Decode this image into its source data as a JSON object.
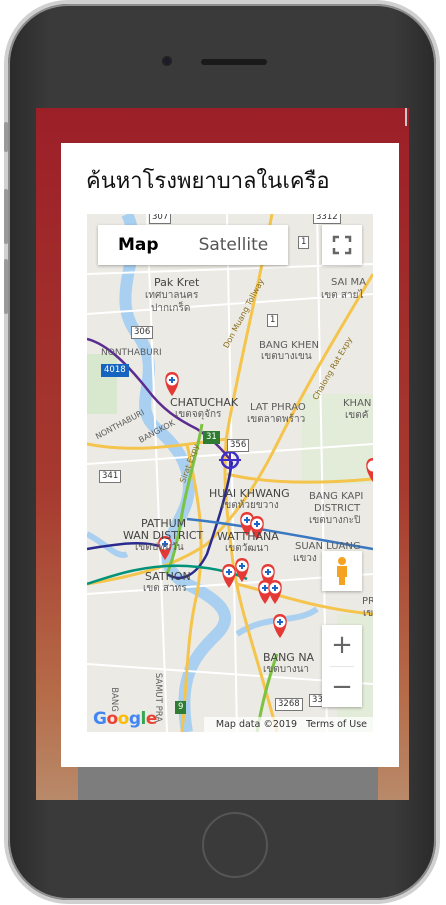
{
  "modal": {
    "title": "ค้นหาโรงพยาบาลในเครือ"
  },
  "map": {
    "map_type": {
      "map_label": "Map",
      "satellite_label": "Satellite"
    },
    "zoom": {
      "in_label": "+",
      "out_label": "−"
    },
    "footer": {
      "map_data": "Map data ©2019",
      "terms": "Terms of Use"
    },
    "google_logo": [
      "G",
      "o",
      "o",
      "g",
      "l",
      "e"
    ],
    "google_colors": [
      "#4285F4",
      "#EA4335",
      "#FBBC05",
      "#4285F4",
      "#34A853",
      "#EA4335"
    ],
    "places": {
      "pak_kret_en": "Pak Kret",
      "pak_kret_th1": "เทศบาลนคร",
      "pak_kret_th2": "ปากเกร็ด",
      "sai_mai_en": "SAI MA",
      "sai_mai_th": "เขต สายไ",
      "bang_khen_en": "BANG KHEN",
      "bang_khen_th": "เขตบางเขน",
      "nonthaburi": "NONTHABURI",
      "chatuchak_en": "CHATUCHAK",
      "chatuchak_th": "เขตจตุจักร",
      "lat_phrao_en": "LAT PHRAO",
      "lat_phrao_th": "เขตลาดพร้าว",
      "khan_en": "KHAN",
      "khan_th": "เขตคั",
      "nonthaburi_bangkok": "NONTHABURI",
      "bangkok": "BANGKOK",
      "huai_khwang_en": "HUAI KHWANG",
      "huai_khwang_th": "เขตห้วยขวาง",
      "bang_kapi_en1": "BANG KAPI",
      "bang_kapi_en2": "DISTRICT",
      "bang_kapi_th": "เขตบางกะปิ",
      "pathum_en1": "PATHUM",
      "pathum_en2": "WAN DISTRICT",
      "pathum_th": "เขตปทุมวัน",
      "watthana_en": "WATTHANA",
      "watthana_th": "เขตวัฒนา",
      "suan_luang_en": "SUAN LUANG",
      "suan_luang_th": "แขวง",
      "sathon_en": "SATHON",
      "sathon_th": "เขต สาทร",
      "bang_na_en": "BANG NA",
      "bang_na_th": "เขตบางนา",
      "pr": "PR",
      "pr_th": "เข",
      "bang": "BANG",
      "samut_pra": "SAMUT PRA"
    },
    "roads": {
      "don_muang": "Don Muang Tollway",
      "chalong_rat": "Chalong Rat Expy",
      "sirat": "Sirat Expy"
    },
    "shields": [
      "307",
      "3312",
      "306",
      "4018",
      "341",
      "31",
      "356",
      "3268",
      "33",
      "9",
      "1",
      "1"
    ],
    "marker_color": "#e53935",
    "marker_cross_color": "#1e63c6",
    "current_location_color": "#3f2fc8"
  }
}
